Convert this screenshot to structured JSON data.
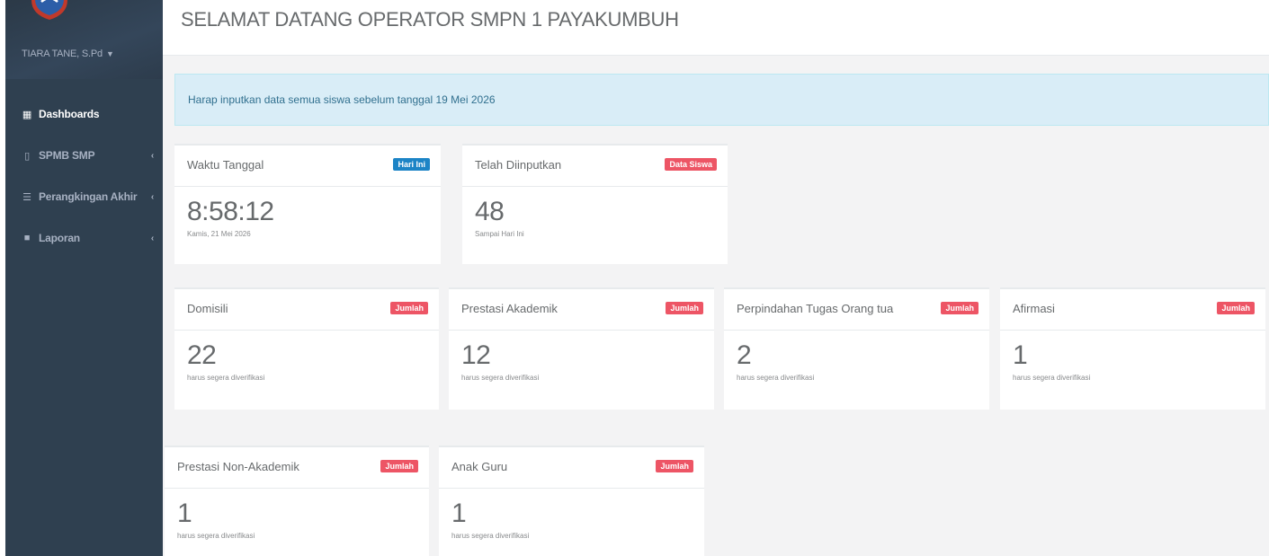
{
  "sidebar": {
    "user_name": "TIARA TANE, S.Pd",
    "items": [
      {
        "label": "Dashboards",
        "icon": "grid-icon"
      },
      {
        "label": "SPMB SMP",
        "icon": "mobile-icon"
      },
      {
        "label": "Perangkingan Akhir",
        "icon": "sliders-icon"
      },
      {
        "label": "Laporan",
        "icon": "file-icon"
      }
    ],
    "arrow": "‹"
  },
  "header": {
    "title": "SELAMAT DATANG OPERATOR SMPN 1 PAYAKUMBUH"
  },
  "alert": {
    "text": "Harap inputkan data semua siswa sebelum tanggal 19 Mei 2026"
  },
  "cards": {
    "waktu": {
      "title": "Waktu Tanggal",
      "badge": "Hari Ini",
      "value": "8:58:12",
      "sub": "Kamis, 21 Mei 2026"
    },
    "diinput": {
      "title": "Telah Diinputkan",
      "badge": "Data Siswa",
      "value": "48",
      "sub": "Sampai Hari Ini"
    },
    "domisili": {
      "title": "Domisili",
      "badge": "Jumlah",
      "value": "22",
      "sub": "harus segera diverifikasi"
    },
    "prestasi_akademik": {
      "title": "Prestasi Akademik",
      "badge": "Jumlah",
      "value": "12",
      "sub": "harus segera diverifikasi"
    },
    "perpindahan": {
      "title": "Perpindahan Tugas Orang tua",
      "badge": "Jumlah",
      "value": "2",
      "sub": "harus segera diverifikasi"
    },
    "afirmasi": {
      "title": "Afirmasi",
      "badge": "Jumlah",
      "value": "1",
      "sub": "harus segera diverifikasi"
    },
    "prestasi_non": {
      "title": "Prestasi Non-Akademik",
      "badge": "Jumlah",
      "value": "1",
      "sub": "harus segera diverifikasi"
    },
    "anak_guru": {
      "title": "Anak Guru",
      "badge": "Jumlah",
      "value": "1",
      "sub": "harus segera diverifikasi"
    }
  },
  "colors": {
    "sidebar": "#2f4050",
    "badge_blue": "#1c84c6",
    "badge_red": "#ed5565",
    "alert_bg": "#d9edf7"
  }
}
